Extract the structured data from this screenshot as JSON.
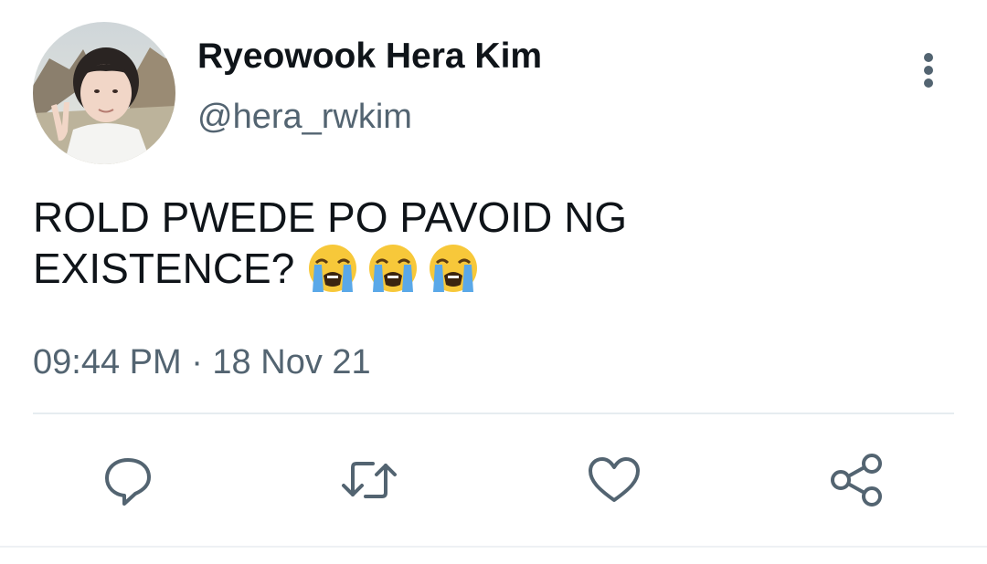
{
  "tweet": {
    "display_name": "Ryeowook Hera Kim",
    "handle": "@hera_rwkim",
    "text_line1": "ROLD PWEDE PO PAVOID NG",
    "text_line2": "EXISTENCE?",
    "emojis": [
      "loudly-crying-face",
      "loudly-crying-face",
      "loudly-crying-face"
    ],
    "timestamp": "09:44 PM · 18 Nov 21"
  },
  "icons": {
    "more": "vertical-dots-icon",
    "reply": "reply-bubble-icon",
    "retweet": "retweet-icon",
    "like": "heart-icon",
    "share": "share-icon"
  },
  "colors": {
    "text_primary": "#0f1419",
    "text_secondary": "#536471",
    "divider": "#e6ecf0"
  }
}
